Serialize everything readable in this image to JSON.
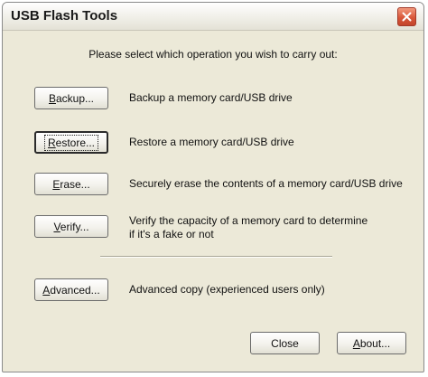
{
  "window": {
    "title": "USB Flash Tools"
  },
  "prompt": "Please select which operation you wish to carry out:",
  "operations": [
    {
      "label": "Backup...",
      "mnemonic_prefix": "",
      "mnemonic": "B",
      "mnemonic_rest": "ackup...",
      "description": "Backup a memory card/USB drive"
    },
    {
      "label": "Restore...",
      "mnemonic_prefix": "",
      "mnemonic": "R",
      "mnemonic_rest": "estore...",
      "description": "Restore a memory card/USB drive"
    },
    {
      "label": "Erase...",
      "mnemonic_prefix": "",
      "mnemonic": "E",
      "mnemonic_rest": "rase...",
      "description": "Securely erase the contents of a memory card/USB drive"
    },
    {
      "label": "Verify...",
      "mnemonic_prefix": "",
      "mnemonic": "V",
      "mnemonic_rest": "erify...",
      "description_line1": "Verify the capacity of a memory card to determine",
      "description_line2": "if it's a fake or not"
    }
  ],
  "advanced": {
    "label": "Advanced...",
    "mnemonic_prefix": "",
    "mnemonic": "A",
    "mnemonic_rest": "dvanced...",
    "description": "Advanced copy (experienced users only)"
  },
  "footer": {
    "close_label": "Close",
    "about_label": "About...",
    "about_mnemonic": "A",
    "about_rest": "bout..."
  },
  "icons": {
    "close": "close-icon"
  },
  "colors": {
    "dialog_background": "#ece9d8",
    "close_button": "#d9573a"
  }
}
